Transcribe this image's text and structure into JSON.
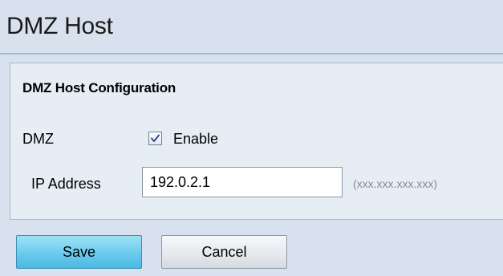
{
  "page": {
    "title": "DMZ Host"
  },
  "section": {
    "title": "DMZ Host Configuration"
  },
  "dmz": {
    "label": "DMZ",
    "checkbox_label": "Enable",
    "enabled": true,
    "check_icon": "checkmark-icon"
  },
  "ip_address": {
    "label": "IP Address",
    "value": "192.0.2.1",
    "hint": "(xxx.xxx.xxx.xxx)"
  },
  "buttons": {
    "save_label": "Save",
    "cancel_label": "Cancel"
  },
  "colors": {
    "background": "#d8e2ee",
    "panel": "#e6edf5",
    "save_button": "#6fcdee",
    "hint_text": "#8a8a8a",
    "checkmark": "#2d4fa3"
  }
}
